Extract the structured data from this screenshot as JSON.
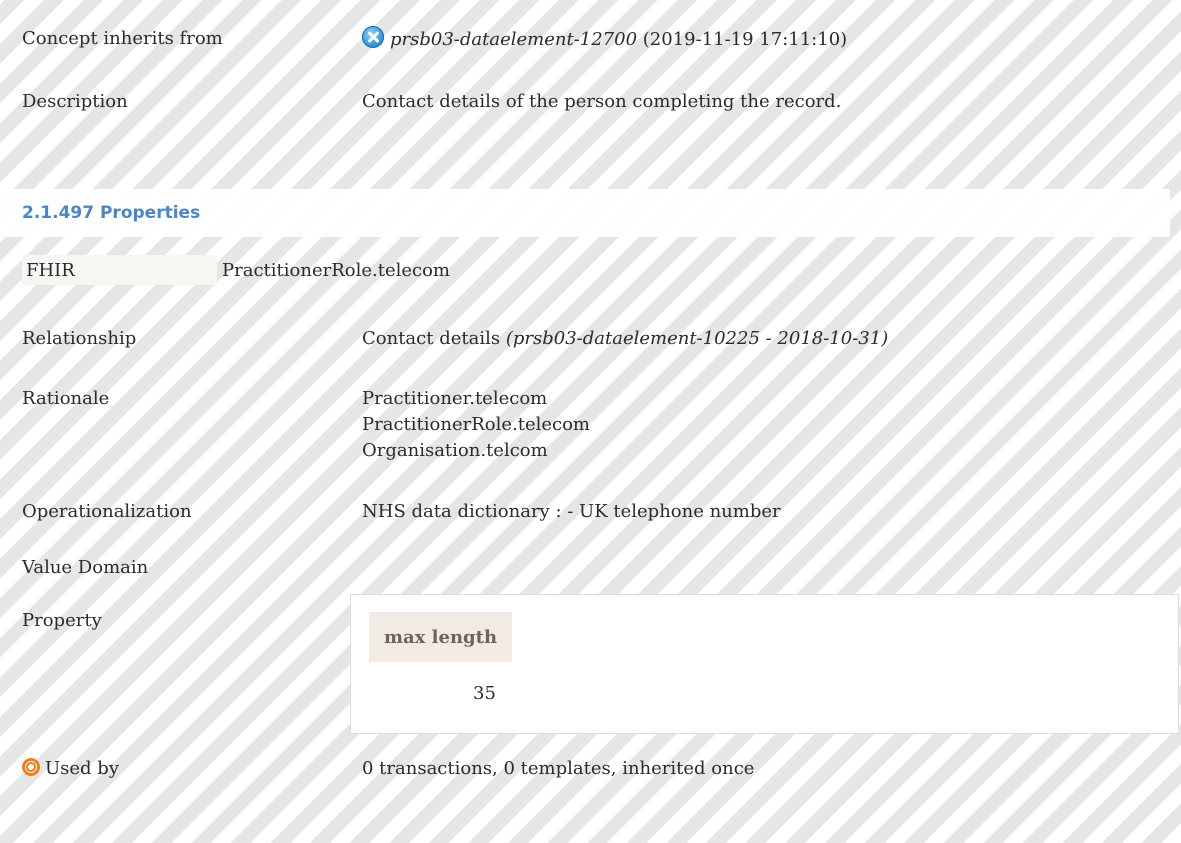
{
  "concept": {
    "inherits_label": "Concept inherits from",
    "inherits_ref": "prsb03-dataelement-12700",
    "inherits_date": "(2019-11-19 17:11:10)",
    "description_label": "Description",
    "description_value": "Contact details of the person completing the record."
  },
  "section": {
    "title": "2.1.497 Properties"
  },
  "properties": {
    "fhir_label": "FHIR",
    "fhir_value": "PractitionerRole.telecom",
    "relationship_label": "Relationship",
    "relationship_value": "Contact details",
    "relationship_ref": "(prsb03-dataelement-10225 - 2018-10-31)",
    "rationale_label": "Rationale",
    "rationale_lines": [
      "Practitioner.telecom",
      "PractitionerRole.telecom",
      "Organisation.telcom"
    ],
    "operationalization_label": "Operationalization",
    "operationalization_value": "NHS data dictionary : - UK telephone number",
    "value_domain_label": "Value Domain",
    "property_label": "Property",
    "property_header": "max length",
    "property_value": "35",
    "used_by_label": "Used by",
    "used_by_value": "0 transactions, 0 templates, inherited once"
  },
  "icons": {
    "inherit_icon": "info-close-icon",
    "used_by_icon": "target-icon"
  }
}
